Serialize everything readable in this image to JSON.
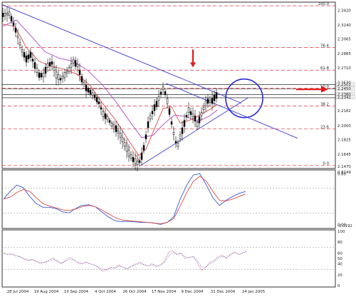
{
  "colors": {
    "background": "#ffffff",
    "frame": "#000000",
    "dashed_levels": "#e0343a",
    "ma_slow": "#b35ac9",
    "ma_fast": "#d94b4b",
    "trendline": "#3a3ad6",
    "stoch_k": "#3a5ad6",
    "stoch_d": "#d94b4b",
    "arrow": "#e01a1a",
    "circle": "#2a2ad6",
    "candles": "#000000",
    "rsi_dots": "#c23a6a",
    "tick_labels": "#222222"
  },
  "chart_data": [
    {
      "type": "candlestick",
      "title": "",
      "x_labels": [
        "28 Jul 2004",
        "19 Aug 2004",
        "10 Sep 2004",
        "4 Oct 2004",
        "26 Oct 2004",
        "17 Nov 2004",
        "9 Dec 2004",
        "31 Dec 2004",
        "24 Jan 2005"
      ],
      "y_tick_labels": [
        "2.3420",
        "2.3240",
        "2.3065",
        "2.2885",
        "2.2710",
        "2.2530",
        "2.2182",
        "2.2000",
        "2.1825",
        "2.1645",
        "2.1470"
      ],
      "price_labels": [
        "2.2503",
        "2.2450",
        "2.2380",
        "2.2342"
      ],
      "ylim": [
        2.147,
        2.352
      ],
      "fib_levels": [
        {
          "label": "100.0",
          "value": 2.3475
        },
        {
          "label": "76.4",
          "value": 2.2961
        },
        {
          "label": "61.8",
          "value": 2.2682
        },
        {
          "label": "50.0",
          "value": 2.246
        },
        {
          "label": "38.2",
          "value": 2.224
        },
        {
          "label": "23.6",
          "value": 2.196
        },
        {
          "label": "0.0",
          "value": 2.151
        }
      ],
      "close_path": [
        {
          "x": 0,
          "v": 2.336
        },
        {
          "x": 10,
          "v": 2.338
        },
        {
          "x": 16,
          "v": 2.325
        },
        {
          "x": 20,
          "v": 2.315
        },
        {
          "x": 28,
          "v": 2.292
        },
        {
          "x": 34,
          "v": 2.282
        },
        {
          "x": 40,
          "v": 2.287
        },
        {
          "x": 46,
          "v": 2.274
        },
        {
          "x": 52,
          "v": 2.262
        },
        {
          "x": 58,
          "v": 2.262
        },
        {
          "x": 64,
          "v": 2.274
        },
        {
          "x": 70,
          "v": 2.277
        },
        {
          "x": 76,
          "v": 2.262
        },
        {
          "x": 82,
          "v": 2.257
        },
        {
          "x": 88,
          "v": 2.262
        },
        {
          "x": 94,
          "v": 2.269
        },
        {
          "x": 100,
          "v": 2.279
        },
        {
          "x": 106,
          "v": 2.274
        },
        {
          "x": 112,
          "v": 2.257
        },
        {
          "x": 118,
          "v": 2.246
        },
        {
          "x": 124,
          "v": 2.241
        },
        {
          "x": 130,
          "v": 2.236
        },
        {
          "x": 136,
          "v": 2.228
        },
        {
          "x": 142,
          "v": 2.214
        },
        {
          "x": 148,
          "v": 2.209
        },
        {
          "x": 154,
          "v": 2.201
        },
        {
          "x": 160,
          "v": 2.196
        },
        {
          "x": 166,
          "v": 2.188
        },
        {
          "x": 172,
          "v": 2.177
        },
        {
          "x": 178,
          "v": 2.166
        },
        {
          "x": 184,
          "v": 2.158
        },
        {
          "x": 190,
          "v": 2.154
        },
        {
          "x": 194,
          "v": 2.156
        },
        {
          "x": 198,
          "v": 2.168
        },
        {
          "x": 202,
          "v": 2.186
        },
        {
          "x": 206,
          "v": 2.206
        },
        {
          "x": 210,
          "v": 2.214
        },
        {
          "x": 214,
          "v": 2.222
        },
        {
          "x": 218,
          "v": 2.228
        },
        {
          "x": 222,
          "v": 2.238
        },
        {
          "x": 226,
          "v": 2.246
        },
        {
          "x": 230,
          "v": 2.238
        },
        {
          "x": 234,
          "v": 2.222
        },
        {
          "x": 238,
          "v": 2.203
        },
        {
          "x": 242,
          "v": 2.186
        },
        {
          "x": 246,
          "v": 2.173
        },
        {
          "x": 250,
          "v": 2.186
        },
        {
          "x": 254,
          "v": 2.196
        },
        {
          "x": 258,
          "v": 2.209
        },
        {
          "x": 262,
          "v": 2.219
        },
        {
          "x": 266,
          "v": 2.214
        },
        {
          "x": 270,
          "v": 2.211
        },
        {
          "x": 274,
          "v": 2.201
        },
        {
          "x": 278,
          "v": 2.209
        },
        {
          "x": 282,
          "v": 2.219
        },
        {
          "x": 286,
          "v": 2.227
        },
        {
          "x": 290,
          "v": 2.231
        },
        {
          "x": 294,
          "v": 2.229
        },
        {
          "x": 298,
          "v": 2.234
        },
        {
          "x": 302,
          "v": 2.238
        }
      ],
      "ma_fast_path": [
        {
          "x": 0,
          "v": 2.325
        },
        {
          "x": 18,
          "v": 2.322
        },
        {
          "x": 34,
          "v": 2.296
        },
        {
          "x": 52,
          "v": 2.279
        },
        {
          "x": 70,
          "v": 2.273
        },
        {
          "x": 88,
          "v": 2.269
        },
        {
          "x": 106,
          "v": 2.263
        },
        {
          "x": 124,
          "v": 2.249
        },
        {
          "x": 142,
          "v": 2.226
        },
        {
          "x": 160,
          "v": 2.206
        },
        {
          "x": 178,
          "v": 2.181
        },
        {
          "x": 192,
          "v": 2.163
        },
        {
          "x": 202,
          "v": 2.171
        },
        {
          "x": 214,
          "v": 2.196
        },
        {
          "x": 226,
          "v": 2.221
        },
        {
          "x": 238,
          "v": 2.223
        },
        {
          "x": 250,
          "v": 2.203
        },
        {
          "x": 262,
          "v": 2.206
        },
        {
          "x": 274,
          "v": 2.211
        },
        {
          "x": 290,
          "v": 2.219
        },
        {
          "x": 302,
          "v": 2.226
        }
      ],
      "ma_slow_path": [
        {
          "x": 0,
          "v": 2.322
        },
        {
          "x": 20,
          "v": 2.33
        },
        {
          "x": 40,
          "v": 2.311
        },
        {
          "x": 60,
          "v": 2.291
        },
        {
          "x": 80,
          "v": 2.283
        },
        {
          "x": 100,
          "v": 2.279
        },
        {
          "x": 120,
          "v": 2.268
        },
        {
          "x": 140,
          "v": 2.251
        },
        {
          "x": 160,
          "v": 2.229
        },
        {
          "x": 180,
          "v": 2.204
        },
        {
          "x": 196,
          "v": 2.185
        },
        {
          "x": 212,
          "v": 2.188
        },
        {
          "x": 226,
          "v": 2.201
        },
        {
          "x": 242,
          "v": 2.213
        },
        {
          "x": 258,
          "v": 2.211
        },
        {
          "x": 274,
          "v": 2.205
        },
        {
          "x": 290,
          "v": 2.211
        },
        {
          "x": 302,
          "v": 2.219
        }
      ],
      "trendlines": [
        {
          "x1": 0,
          "v1": 2.349,
          "x2": 336,
          "v2": 2.2275
        },
        {
          "x1": 195,
          "v1": 2.151,
          "x2": 346,
          "v2": 2.2345
        },
        {
          "x1": 230,
          "v1": 2.252,
          "x2": 415,
          "v2": 2.1842
        },
        {
          "x1": 100,
          "v1": 2.269,
          "x2": 195,
          "v2": 2.154
        }
      ],
      "annotations": [
        "down arrow at December 2004 high",
        "right arrow at 50.0 level",
        "circle at January 2005 price"
      ]
    },
    {
      "type": "line",
      "title": "",
      "y_tick_labels": [
        "0.8149",
        "0.80",
        "0.00",
        "-0.0192"
      ],
      "ylim": [
        -0.0192,
        0.8149
      ],
      "series": [
        {
          "values": [
            0.4,
            0.52,
            0.62,
            0.58,
            0.44,
            0.33,
            0.27,
            0.27,
            0.25,
            0.2,
            0.18,
            0.25,
            0.3,
            0.31,
            0.28,
            0.2,
            0.12,
            0.06,
            0.04,
            0.05,
            0.04,
            0.03,
            0.03,
            0.02,
            0.0,
            0.03,
            0.12,
            0.4,
            0.62,
            0.78,
            0.8,
            0.62,
            0.42,
            0.3,
            0.38,
            0.44,
            0.49,
            0.52
          ]
        },
        {
          "values": [
            0.4,
            0.43,
            0.5,
            0.55,
            0.52,
            0.42,
            0.33,
            0.29,
            0.26,
            0.23,
            0.22,
            0.24,
            0.28,
            0.3,
            0.28,
            0.23,
            0.17,
            0.11,
            0.07,
            0.06,
            0.05,
            0.04,
            0.03,
            0.02,
            0.01,
            0.03,
            0.09,
            0.29,
            0.5,
            0.68,
            0.76,
            0.68,
            0.52,
            0.38,
            0.37,
            0.4,
            0.44,
            0.48
          ]
        }
      ]
    },
    {
      "type": "line",
      "title": "",
      "y_tick_labels": [
        "100",
        "80",
        "60",
        "50",
        "40",
        "20",
        "0"
      ],
      "ylim": [
        0,
        100
      ],
      "series": [
        {
          "values": [
            60,
            57,
            59,
            55,
            53,
            48,
            46,
            49,
            44,
            41,
            43,
            47,
            51,
            44,
            40,
            46,
            52,
            48,
            42,
            40,
            44,
            40,
            38,
            33,
            27,
            29,
            34,
            32,
            38,
            33,
            30,
            36,
            40,
            43,
            38,
            36,
            40,
            35,
            38,
            45,
            62,
            64,
            57,
            60,
            50,
            52,
            54,
            41,
            28,
            33,
            43,
            46,
            53,
            56,
            50,
            58,
            62,
            57,
            60,
            64
          ]
        },
        {
          "values": [
            58,
            58,
            57,
            55,
            53,
            50,
            47,
            47,
            45,
            42,
            43,
            45,
            48,
            46,
            42,
            45,
            48,
            47,
            43,
            41,
            42,
            40,
            38,
            34,
            30,
            30,
            32,
            33,
            36,
            34,
            32,
            35,
            38,
            41,
            39,
            37,
            38,
            36,
            38,
            42,
            55,
            61,
            58,
            59,
            53,
            52,
            53,
            45,
            34,
            34,
            40,
            44,
            50,
            54,
            52,
            56,
            60,
            58,
            60,
            63
          ]
        }
      ]
    }
  ]
}
